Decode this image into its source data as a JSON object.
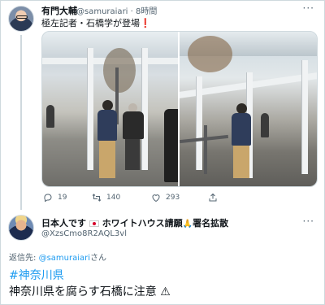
{
  "tweet1": {
    "author_name": "有門大輔",
    "handle": "@samuraiari",
    "separator": "·",
    "time": "8時間",
    "handle_time": "@samuraiari · 8時間",
    "text": "極左記者・石橋学が登場",
    "text_suffix_emoji": "❗",
    "more_icon": "more-dots-icon",
    "photos": [
      {
        "name": "photo-left",
        "desc_icon": "photo-icon"
      },
      {
        "name": "photo-right",
        "desc_icon": "photo-icon"
      }
    ],
    "actions": {
      "reply_count": "19",
      "retweet_count": "140",
      "like_count": "293"
    }
  },
  "tweet2": {
    "author_name_part1": "日本人です",
    "author_name_part2": "ホワイトハウス請願",
    "author_name_part3": "署名拡散",
    "handle": "@XzsCmo8R2AQL3vl",
    "reply_label": "返信先:",
    "reply_mention": "@samuraiari",
    "reply_suffix": "さん",
    "hashtag": "#神奈川県",
    "text": "神奈川県を腐らす石橋に注意",
    "warning_emoji": "⚠"
  },
  "colors": {
    "link": "#1d9bf0",
    "muted": "#536471",
    "text": "#0f1419",
    "border": "#cfd9de"
  }
}
